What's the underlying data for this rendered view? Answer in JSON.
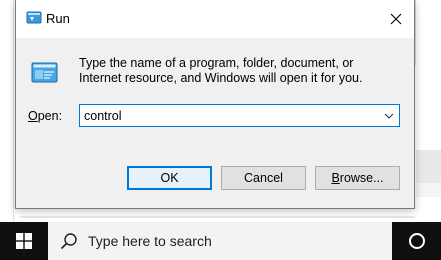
{
  "dialog": {
    "title": "Run",
    "description": "Type the name of a program, folder, document, or Internet resource, and Windows will open it for you.",
    "open_label_underlined": "O",
    "open_label_rest": "pen:",
    "open_value": "control",
    "buttons": {
      "ok": "OK",
      "cancel": "Cancel",
      "browse_underlined": "B",
      "browse_rest": "rowse..."
    }
  },
  "taskbar": {
    "search_placeholder": "Type here to search"
  },
  "colors": {
    "accent": "#0078d7",
    "taskbar": "#101010",
    "dialog_bg": "#f0f0f0"
  },
  "icons": [
    "run-icon",
    "close-icon",
    "chevron-down-icon",
    "windows-start-icon",
    "search-icon",
    "cortana-icon"
  ]
}
